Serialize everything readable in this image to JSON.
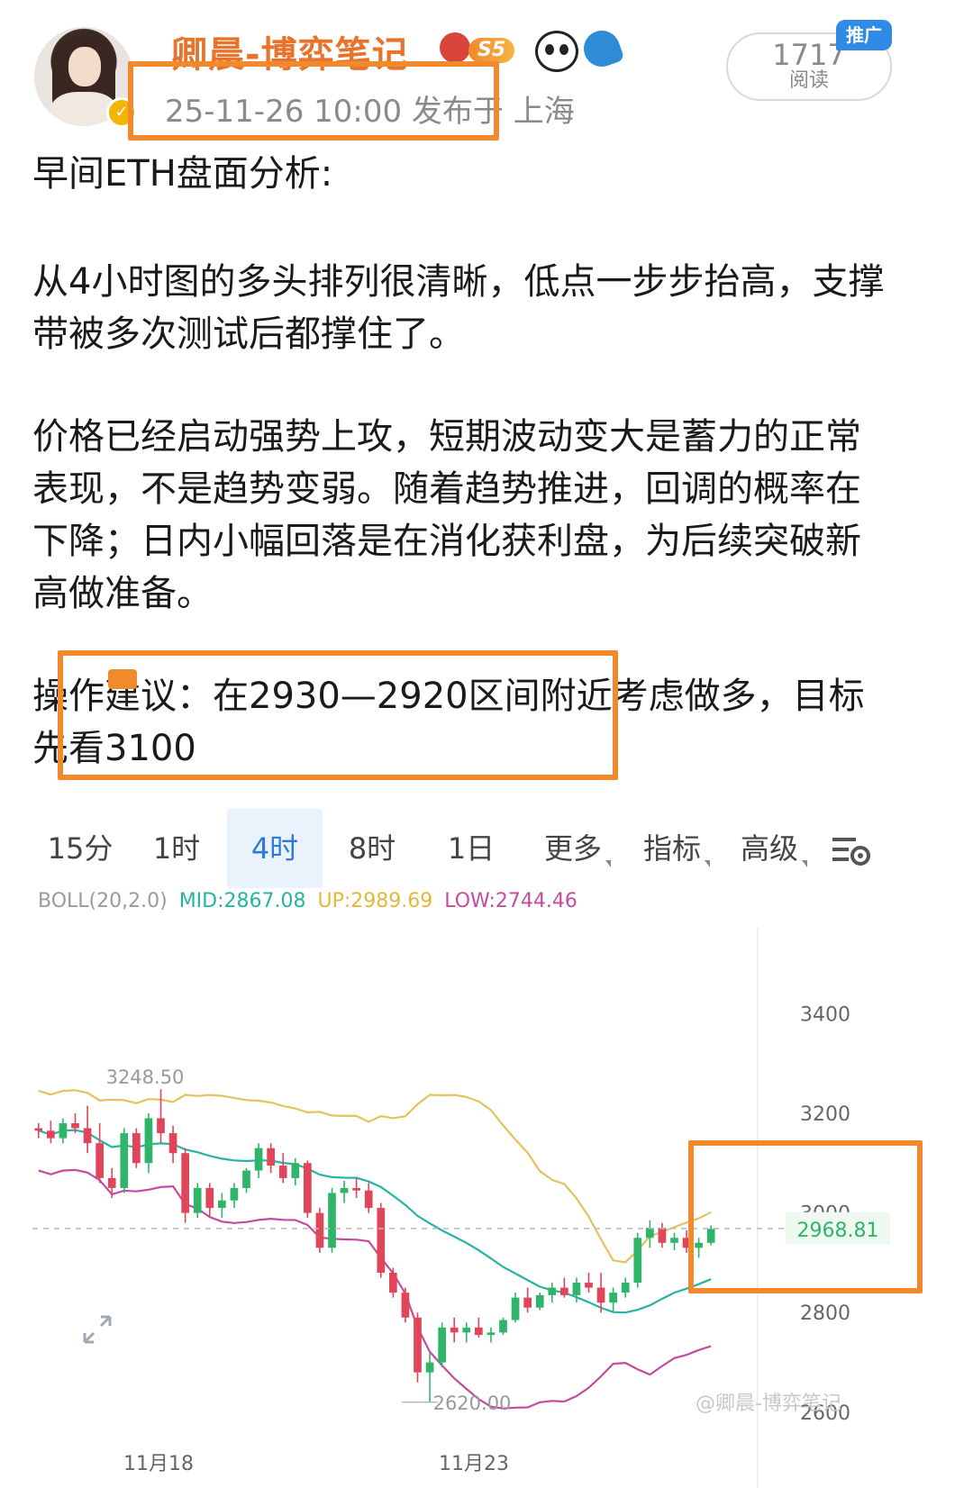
{
  "header": {
    "username": "卿晨-博弈笔记",
    "level_badge": "S5",
    "meta": "25-11-26 10:00  发布于 上海",
    "read_count": "1717",
    "read_label": "阅读",
    "promo_badge": "推广",
    "icons": [
      "avatar",
      "verified-badge-icon",
      "medal-icon",
      "panda-icon",
      "shark-icon"
    ]
  },
  "post": {
    "title": "早间ETH盘面分析:",
    "paragraph1": "从4小时图的多头排列很清晰，低点一步步抬高，支撑带被多次测试后都撑住了。",
    "paragraph2": "价格已经启动强势上攻，短期波动变大是蓄力的正常表现，不是趋势变弱。随着趋势推进，回调的概率在下降；日内小幅回落是在消化获利盘，为后续突破新高做准备。",
    "paragraph3": "操作建议：在2930—2920区间附近考虑做多，目标先看3100"
  },
  "chart_toolbar": {
    "tabs": [
      {
        "label": "15分",
        "active": false
      },
      {
        "label": "1时",
        "active": false
      },
      {
        "label": "4时",
        "active": true
      },
      {
        "label": "8时",
        "active": false
      },
      {
        "label": "1日",
        "active": false
      },
      {
        "label": "更多",
        "active": false
      },
      {
        "label": "指标",
        "active": false
      },
      {
        "label": "高级",
        "active": false
      }
    ]
  },
  "indicator": {
    "label": "BOLL(20,2.0)",
    "mid": "MID:2867.08",
    "up": "UP:2989.69",
    "low": "LOW:2744.46"
  },
  "chart_data": {
    "type": "candlestick",
    "y_ticks": [
      "3400",
      "3200",
      "3000",
      "2800",
      "2600"
    ],
    "x_ticks": [
      "11月18",
      "11月23"
    ],
    "annotations": [
      "3248.50",
      "2620.00"
    ],
    "current_price": "2968.81",
    "ylim": [
      2560,
      3500
    ],
    "colors": {
      "up": "#2fb56a",
      "down": "#e0455a",
      "mid": "#27b3a3",
      "upper": "#e3c35a",
      "lower": "#c44aa2"
    },
    "candles": [
      [
        3170,
        3180,
        3150,
        3165
      ],
      [
        3165,
        3185,
        3140,
        3150
      ],
      [
        3150,
        3190,
        3140,
        3180
      ],
      [
        3180,
        3200,
        3160,
        3170
      ],
      [
        3170,
        3215,
        3120,
        3140
      ],
      [
        3140,
        3180,
        3060,
        3070
      ],
      [
        3070,
        3090,
        3030,
        3050
      ],
      [
        3050,
        3170,
        3040,
        3160
      ],
      [
        3160,
        3170,
        3090,
        3100
      ],
      [
        3100,
        3200,
        3080,
        3190
      ],
      [
        3190,
        3248,
        3140,
        3160
      ],
      [
        3160,
        3175,
        3100,
        3120
      ],
      [
        3120,
        3130,
        2980,
        3000
      ],
      [
        3000,
        3060,
        2990,
        3050
      ],
      [
        3050,
        3060,
        2990,
        3010
      ],
      [
        3010,
        3040,
        2990,
        3025
      ],
      [
        3025,
        3060,
        3010,
        3050
      ],
      [
        3050,
        3090,
        3040,
        3085
      ],
      [
        3085,
        3140,
        3070,
        3130
      ],
      [
        3130,
        3140,
        3080,
        3095
      ],
      [
        3095,
        3120,
        3060,
        3070
      ],
      [
        3070,
        3110,
        3055,
        3100
      ],
      [
        3100,
        3105,
        2990,
        3000
      ],
      [
        3000,
        3010,
        2920,
        2930
      ],
      [
        2930,
        3050,
        2920,
        3040
      ],
      [
        3040,
        3065,
        3020,
        3050
      ],
      [
        3050,
        3070,
        3030,
        3045
      ],
      [
        3045,
        3060,
        3000,
        3010
      ],
      [
        3010,
        3020,
        2870,
        2880
      ],
      [
        2880,
        2890,
        2830,
        2840
      ],
      [
        2840,
        2850,
        2780,
        2790
      ],
      [
        2790,
        2800,
        2660,
        2680
      ],
      [
        2680,
        2720,
        2620,
        2700
      ],
      [
        2700,
        2780,
        2690,
        2770
      ],
      [
        2770,
        2790,
        2740,
        2760
      ],
      [
        2760,
        2780,
        2740,
        2770
      ],
      [
        2770,
        2790,
        2750,
        2755
      ],
      [
        2755,
        2770,
        2740,
        2760
      ],
      [
        2760,
        2790,
        2755,
        2785
      ],
      [
        2785,
        2840,
        2780,
        2830
      ],
      [
        2830,
        2850,
        2800,
        2810
      ],
      [
        2810,
        2840,
        2805,
        2835
      ],
      [
        2835,
        2860,
        2820,
        2850
      ],
      [
        2850,
        2870,
        2830,
        2835
      ],
      [
        2835,
        2870,
        2820,
        2860
      ],
      [
        2860,
        2880,
        2840,
        2850
      ],
      [
        2850,
        2880,
        2800,
        2820
      ],
      [
        2820,
        2850,
        2800,
        2840
      ],
      [
        2840,
        2870,
        2830,
        2860
      ],
      [
        2860,
        2960,
        2850,
        2950
      ],
      [
        2950,
        2985,
        2930,
        2970
      ],
      [
        2970,
        2980,
        2930,
        2940
      ],
      [
        2940,
        2960,
        2925,
        2950
      ],
      [
        2950,
        2965,
        2920,
        2930
      ],
      [
        2930,
        2950,
        2910,
        2940
      ],
      [
        2940,
        2975,
        2935,
        2968
      ]
    ]
  },
  "watermark": "@卿晨-博弈笔记"
}
